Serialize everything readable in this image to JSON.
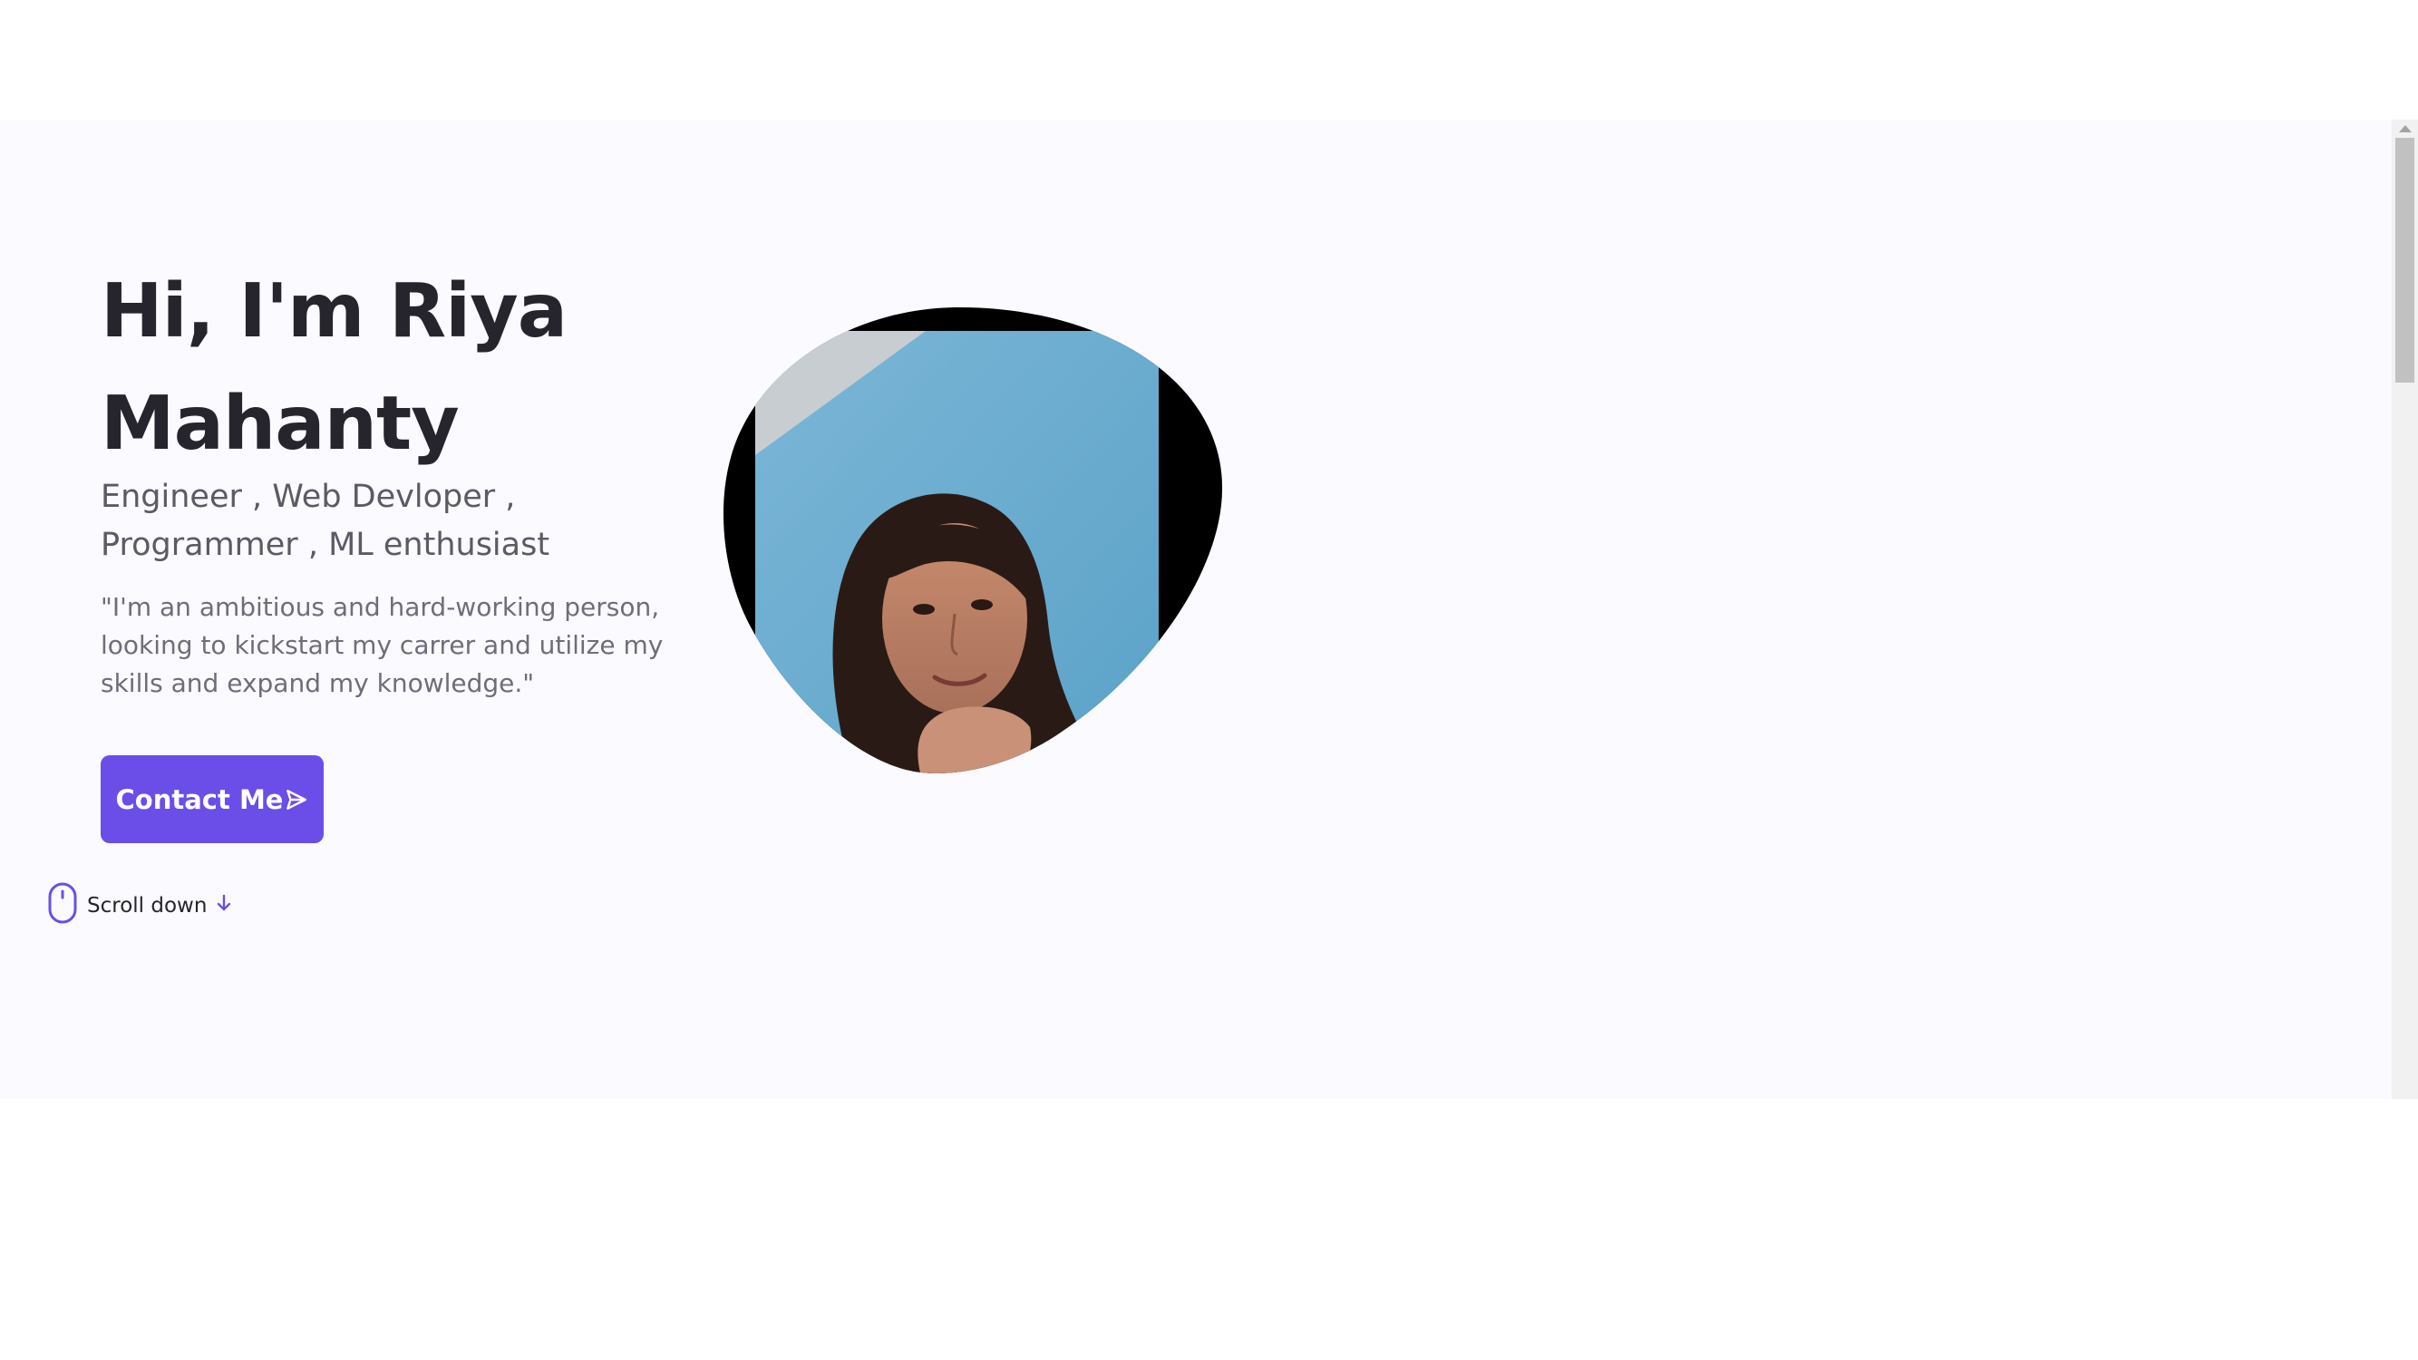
{
  "hero": {
    "title": "Hi, I'm Riya Mahanty",
    "subtitle": "Engineer , Web Devloper , Programmer , ML enthusiast",
    "description": "\"I'm an ambitious and hard-working person, looking to kickstart my carrer and utilize my skills and expand my knowledge.\"",
    "contact_button_label": "Contact Me",
    "scroll_down_label": "Scroll down",
    "image_alt": "Portrait photo of Riya Mahanty"
  },
  "icons": {
    "contact": "send-icon",
    "mouse": "mouse-icon",
    "arrow": "arrow-down-icon"
  },
  "colors": {
    "accent": "#6b4ee8",
    "title": "#26252e",
    "subtitle": "#5b5a66",
    "text": "#6f6d7a",
    "background": "#fbfaff"
  }
}
